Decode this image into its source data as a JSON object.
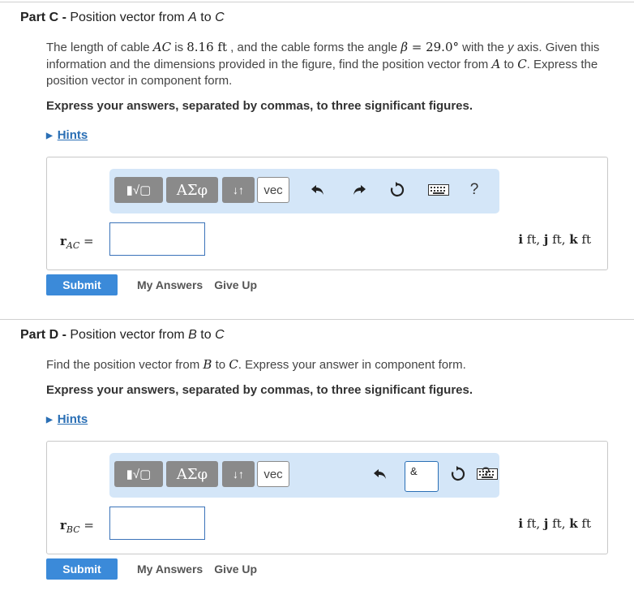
{
  "partC": {
    "label": "Part C",
    "sep": " - ",
    "title_pre": "Position vector from ",
    "from": "A",
    "title_mid": " to ",
    "to": "C",
    "desc": {
      "t1": "The length of cable ",
      "m1": "AC",
      "t2": " is ",
      "m2": "8.16 ft",
      "t3": " , and the cable forms the angle ",
      "m3": "β",
      "m4": " = 29.0°",
      "t4": " with the ",
      "m5": "y",
      "t5": " axis. Given this information and the dimensions provided in the figure, find the position vector from ",
      "m6": "A",
      "t6": " to ",
      "m7": "C",
      "t7": ". Express the position vector in component form."
    },
    "instruction": "Express your answers, separated by commas, to three significant figures.",
    "hints": "Hints",
    "toolbar": {
      "matrix": "▮√▢",
      "greek": "ΑΣφ",
      "arrows": "↓↑",
      "vec": "vec",
      "help": "?"
    },
    "var_main": "r",
    "var_sub": "AC",
    "equals": " =",
    "input_value": "",
    "units": {
      "i": "i",
      "ift": " ft, ",
      "j": "j",
      "jft": " ft, ",
      "k": "k",
      "kft": " ft"
    },
    "submit": "Submit",
    "my_answers": "My Answers",
    "give_up": "Give Up"
  },
  "partD": {
    "label": "Part D",
    "sep": " - ",
    "title_pre": "Position vector from ",
    "from": "B",
    "title_mid": " to ",
    "to": "C",
    "desc": {
      "t1": "Find the position vector from ",
      "m1": "B",
      "t2": " to ",
      "m2": "C",
      "t3": ". Express your answer in component form."
    },
    "instruction": "Express your answers, separated by commas, to three significant figures.",
    "hints": "Hints",
    "toolbar": {
      "matrix": "▮√▢",
      "greek": "ΑΣφ",
      "arrows": "↓↑",
      "vec": "vec",
      "amp": "&",
      "help": "?"
    },
    "var_main": "r",
    "var_sub": "BC",
    "equals": " =",
    "input_value": "",
    "units": {
      "i": "i",
      "ift": " ft, ",
      "j": "j",
      "jft": " ft, ",
      "k": "k",
      "kft": " ft"
    },
    "submit": "Submit",
    "my_answers": "My Answers",
    "give_up": "Give Up"
  },
  "icons": {
    "undo": "undo-icon",
    "redo": "redo-icon",
    "reset": "reset-icon",
    "keyboard": "keyboard-icon"
  },
  "colors": {
    "accent": "#3b8ad9",
    "toolbar_bg": "#d4e6f8",
    "link": "#2a6fb5"
  }
}
